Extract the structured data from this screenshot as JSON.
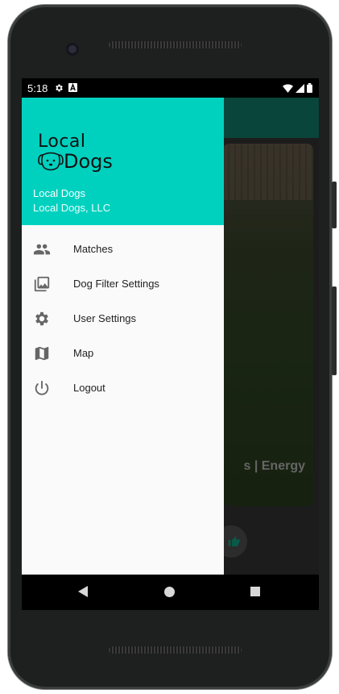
{
  "status_bar": {
    "time": "5:18",
    "left_icons": [
      "settings-icon",
      "a-notification-icon"
    ],
    "right_icons": [
      "wifi-icon",
      "signal-icon",
      "battery-icon"
    ]
  },
  "drawer": {
    "logo_line1": "Local",
    "logo_line2": "Dogs",
    "header_title": "Local Dogs",
    "header_subtitle": "Local Dogs, LLC",
    "accent_color": "#00d1bf",
    "items": [
      {
        "label": "Matches",
        "icon": "people-icon"
      },
      {
        "label": "Dog Filter Settings",
        "icon": "photo-library-icon"
      },
      {
        "label": "User Settings",
        "icon": "gear-icon"
      },
      {
        "label": "Map",
        "icon": "map-icon"
      },
      {
        "label": "Logout",
        "icon": "power-icon"
      }
    ]
  },
  "background_card": {
    "visible_text": "s | Energy"
  },
  "navigation_bar": {
    "buttons": [
      "back",
      "home",
      "recents"
    ]
  }
}
